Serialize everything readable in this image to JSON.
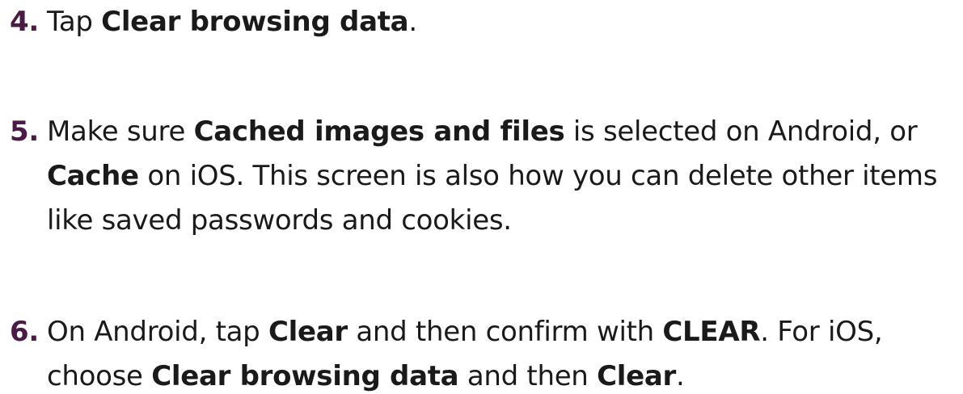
{
  "steps": [
    {
      "number": "4.",
      "lines": [
        [
          {
            "t": "Tap ",
            "b": false
          },
          {
            "t": "Clear browsing data",
            "b": true
          },
          {
            "t": ".",
            "b": false
          }
        ]
      ]
    },
    {
      "number": "5.",
      "lines": [
        [
          {
            "t": "Make sure ",
            "b": false
          },
          {
            "t": "Cached images and files",
            "b": true
          },
          {
            "t": " is selected on Android, or",
            "b": false
          }
        ],
        [
          {
            "t": "Cache",
            "b": true
          },
          {
            "t": " on iOS. This screen is also how you can delete other items",
            "b": false
          }
        ],
        [
          {
            "t": "like saved passwords and cookies.",
            "b": false
          }
        ]
      ]
    },
    {
      "number": "6.",
      "lines": [
        [
          {
            "t": "On Android, tap ",
            "b": false
          },
          {
            "t": "Clear",
            "b": true
          },
          {
            "t": " and then confirm with ",
            "b": false
          },
          {
            "t": "CLEAR",
            "b": true
          },
          {
            "t": ". For iOS,",
            "b": false
          }
        ],
        [
          {
            "t": "choose ",
            "b": false
          },
          {
            "t": "Clear browsing data",
            "b": true
          },
          {
            "t": " and then ",
            "b": false
          },
          {
            "t": "Clear",
            "b": true
          },
          {
            "t": ".",
            "b": false
          }
        ]
      ]
    }
  ],
  "colors": {
    "number": "#4a1c45",
    "text": "#1a1a1a",
    "background": "#ffffff"
  }
}
